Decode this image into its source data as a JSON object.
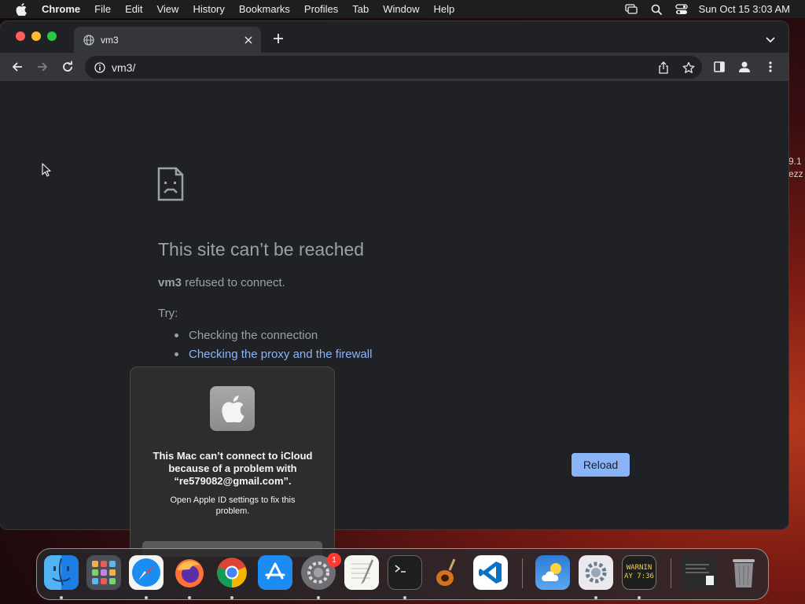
{
  "menubar": {
    "app_name": "Chrome",
    "items": [
      "File",
      "Edit",
      "View",
      "History",
      "Bookmarks",
      "Profiles",
      "Tab",
      "Window",
      "Help"
    ],
    "clock": "Sun Oct 15  3:03 AM"
  },
  "browser": {
    "tab_title": "vm3",
    "url": "vm3/"
  },
  "error_page": {
    "title": "This site can’t be reached",
    "host": "vm3",
    "message_rest": " refused to connect.",
    "try_label": "Try:",
    "suggestions": [
      "Checking the connection",
      "Checking the proxy and the firewall"
    ],
    "reload_label": "Reload"
  },
  "notification": {
    "title": "This Mac can’t connect to iCloud because of a problem with “re579082@gmail.com”.",
    "body": "Open Apple ID settings to fix this problem."
  },
  "desktop_side_text": [
    "9.1",
    "ezz"
  ],
  "dock": {
    "apps": [
      "finder",
      "launchpad",
      "safari",
      "firefox",
      "chrome",
      "app-store",
      "system-preferences",
      "textedit",
      "terminal",
      "garageband",
      "vscode",
      "weather",
      "settings-2",
      "console",
      "notes-file",
      "trash"
    ],
    "system_preferences_badge": "1",
    "console_text": [
      "WARNIN",
      "AY 7:36"
    ]
  },
  "colors": {
    "window_bg": "#202124",
    "toolbar_bg": "#35363a",
    "link": "#8ab4f8",
    "text_muted": "#9aa0a6",
    "reload_bg": "#8ab4f8"
  }
}
